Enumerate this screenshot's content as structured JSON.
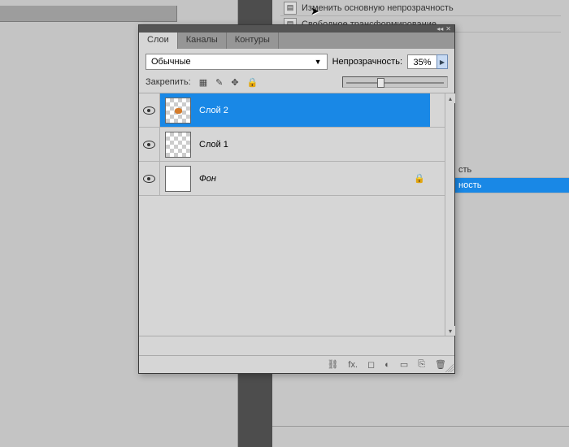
{
  "bg_menu": [
    {
      "label": "Изменить основную непрозрачность"
    },
    {
      "label": "Свободное трансформирование"
    }
  ],
  "bg_side": {
    "row1": "сть",
    "row2": "ность"
  },
  "panel": {
    "tabs": {
      "layers": "Слои",
      "channels": "Каналы",
      "paths": "Контуры"
    },
    "blend_mode": "Обычные",
    "opacity_label": "Непрозрачность:",
    "opacity_value": "35%",
    "lock_label": "Закрепить:"
  },
  "layers": [
    {
      "name": "Слой 2",
      "selected": true,
      "thumb": "checker-dot",
      "locked": false,
      "italic": false
    },
    {
      "name": "Слой 1",
      "selected": false,
      "thumb": "checker",
      "locked": false,
      "italic": false
    },
    {
      "name": "Фон",
      "selected": false,
      "thumb": "white",
      "locked": true,
      "italic": true
    }
  ],
  "footer_icons": {
    "link": "⛓",
    "fx": "fx.",
    "mask": "◻",
    "adj": "◐",
    "group": "▭",
    "new": "⎘",
    "trash": "🗑"
  }
}
